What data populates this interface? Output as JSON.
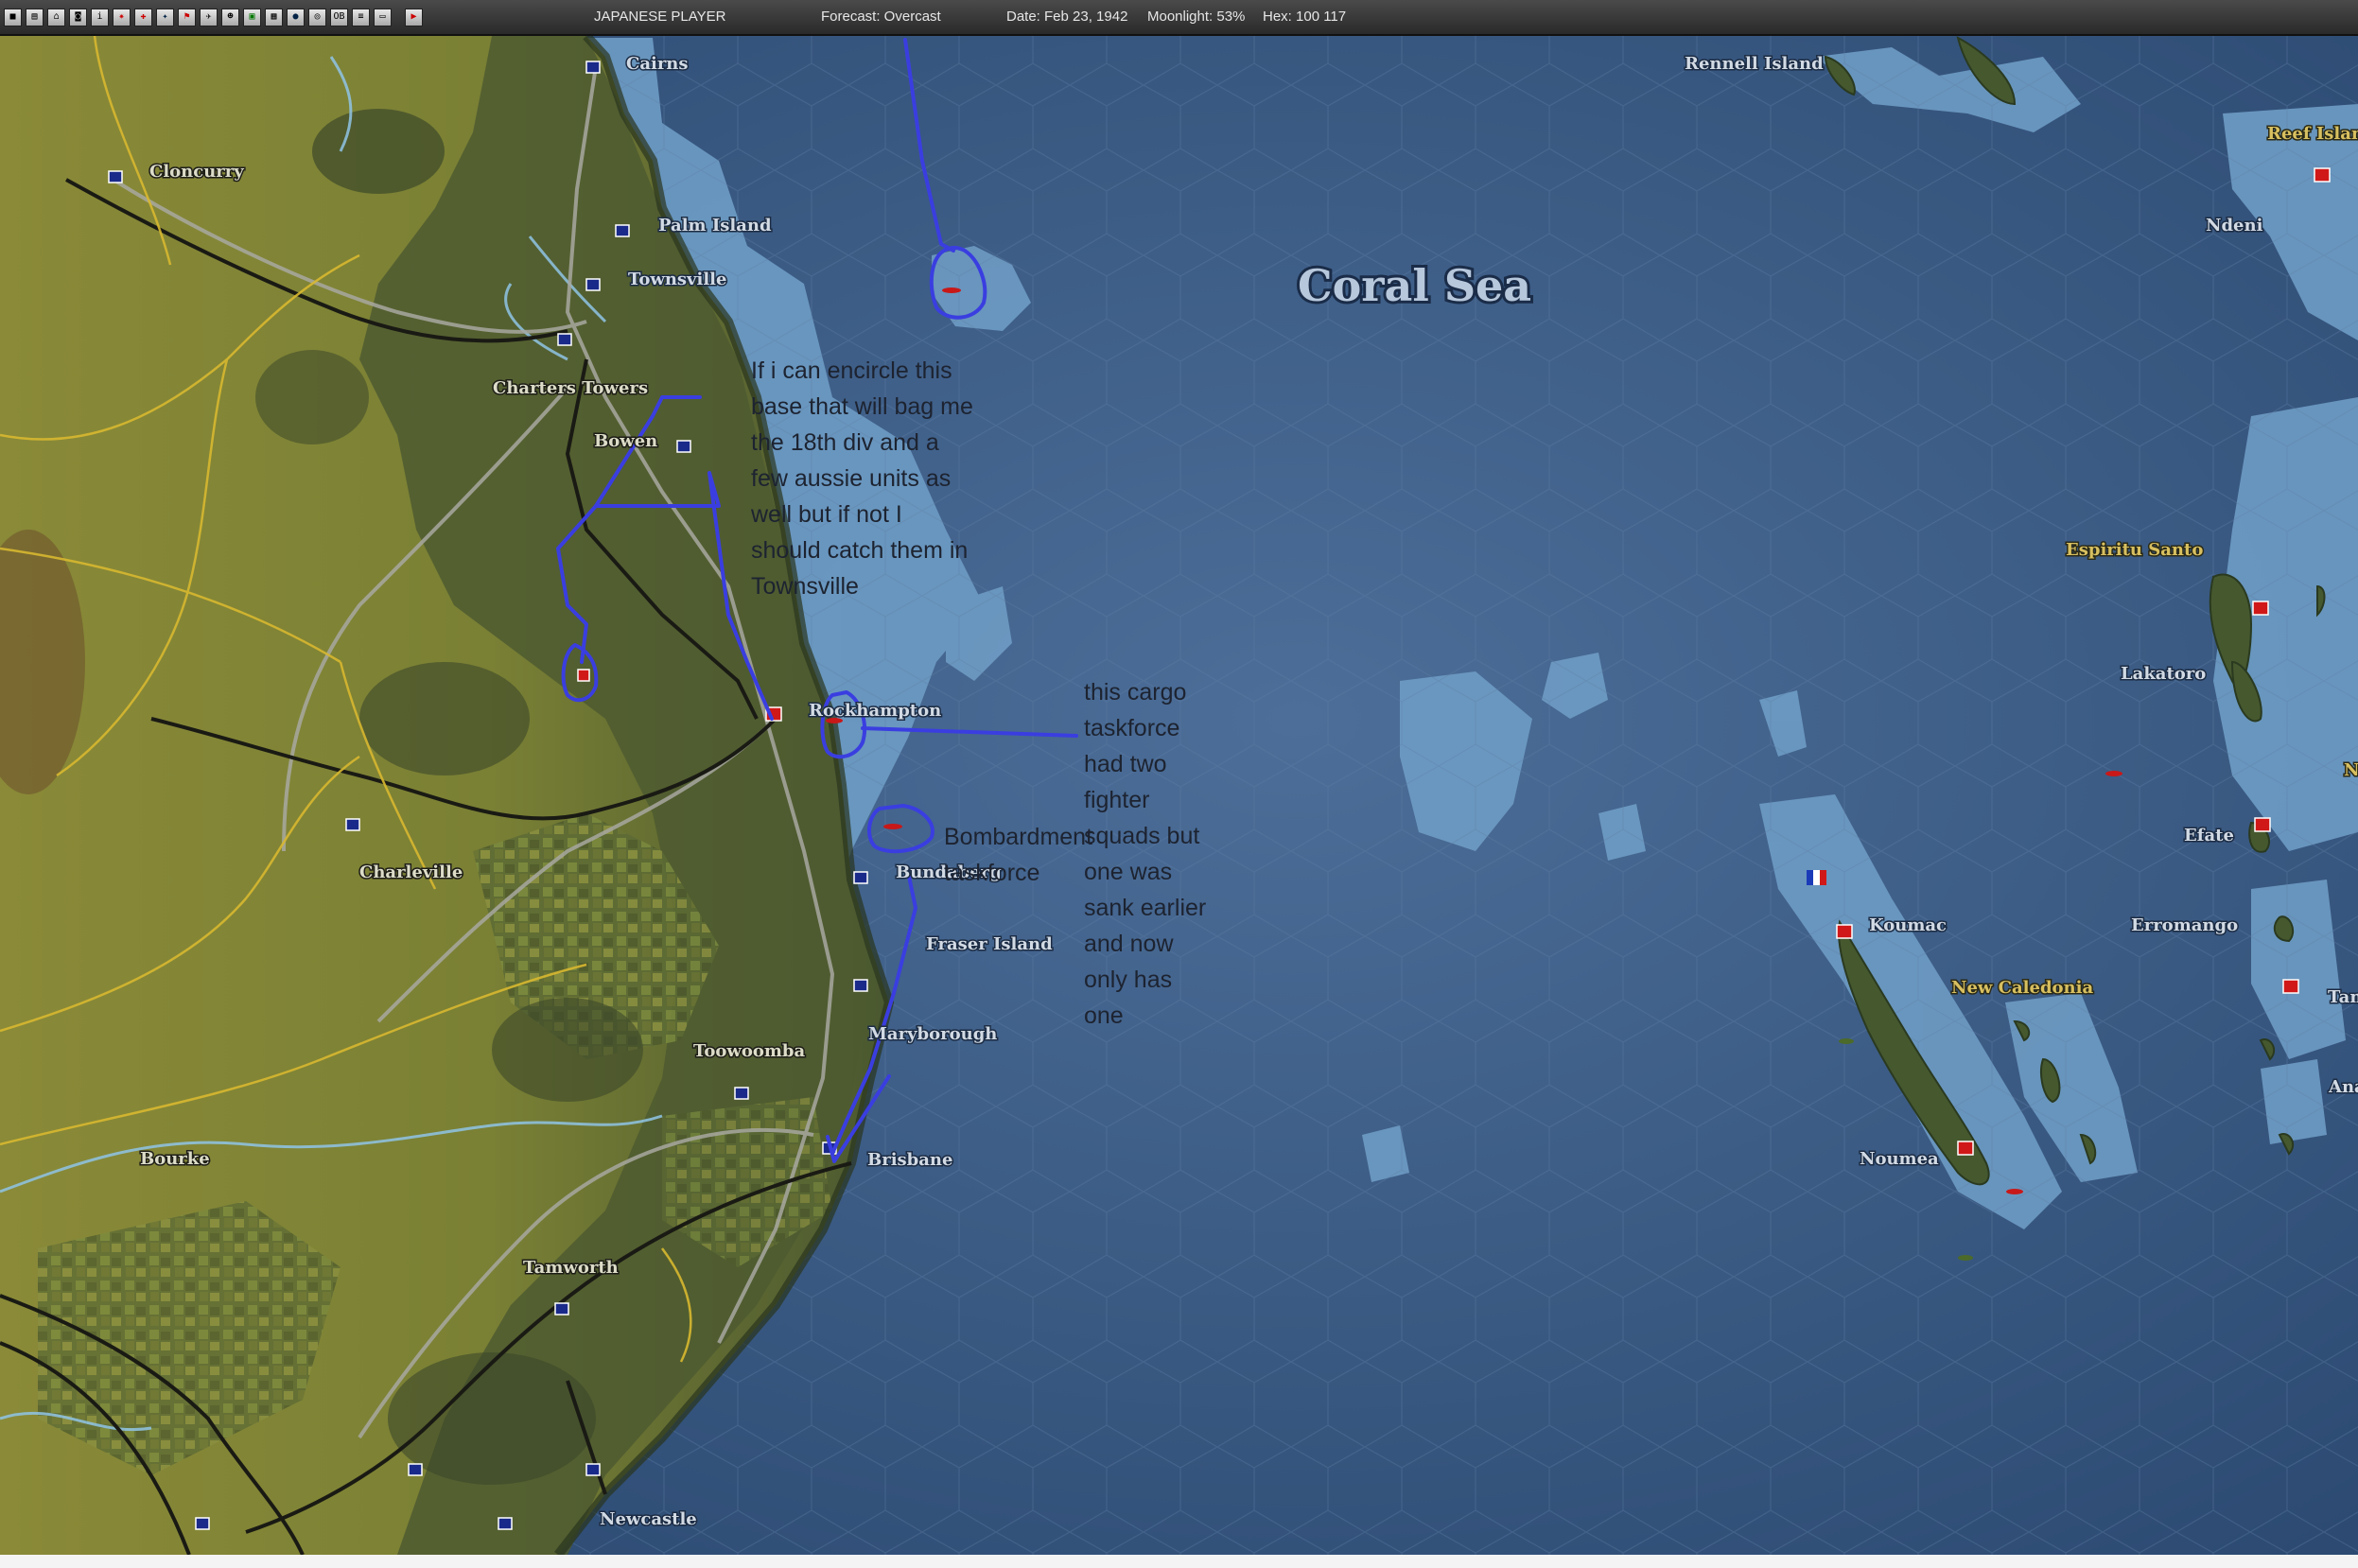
{
  "toolbar": {
    "buttons": [
      "save-icon",
      "report-icon",
      "airgroup-icon",
      "taskforce-icon",
      "info-icon",
      "combat-icon",
      "medical-icon",
      "ship-icon",
      "flag-icon",
      "aircraft-icon",
      "leader-icon",
      "base-icon",
      "unit-icon",
      "globe-icon",
      "intel-icon",
      "ob-icon",
      "list-icon",
      "window-icon",
      "end-turn-icon"
    ],
    "ob_label": "OB",
    "player": "JAPANESE PLAYER",
    "forecast": "Forecast: Overcast",
    "date": "Date: Feb 23, 1942",
    "moonlight": "Moonlight: 53%",
    "hex": "Hex: 100 117"
  },
  "map": {
    "sea_name": "Coral Sea",
    "cities": {
      "cairns": "Cairns",
      "cloncurry": "Cloncurry",
      "palm_island": "Palm Island",
      "townsville": "Townsville",
      "charters_towers": "Charters Towers",
      "bowen": "Bowen",
      "rockhampton": "Rockhampton",
      "bundaberg": "Bundaberg",
      "charleville": "Charleville",
      "fraser_island": "Fraser Island",
      "maryborough": "Maryborough",
      "toowoomba": "Toowoomba",
      "bourke": "Bourke",
      "brisbane": "Brisbane",
      "tamworth": "Tamworth",
      "newcastle": "Newcastle",
      "rennell_island": "Rennell Island",
      "reef_islands": "Reef Islan",
      "ndeni": "Ndeni",
      "espiritu_santo": "Espiritu Santo",
      "lakatoro": "Lakatoro",
      "efate": "Efate",
      "koumac": "Koumac",
      "erromango": "Erromango",
      "new_caledonia": "New Caledonia",
      "tan": "Tan",
      "ana": "Ana",
      "n": "N",
      "noumea": "Noumea"
    }
  },
  "annotations": {
    "note1": [
      "If i can encircle this",
      "base that will bag me",
      "the 18th div and a",
      "few aussie units as",
      "well but if not I",
      "should catch them in",
      "Townsville"
    ],
    "note2": [
      "this cargo",
      "taskforce",
      "had two",
      "fighter",
      "squads but",
      "one was",
      "sank earlier",
      "and now",
      "only has",
      "one"
    ],
    "note3": [
      "Bombardment",
      "taskforce"
    ]
  },
  "colors": {
    "sea_deep": "#2e4f78",
    "sea_shallow": "#6f9ec4",
    "land_olive": "#8e8c34",
    "land_forest": "#46502e",
    "annotation_blue": "#3a3ee0",
    "allied_base_red": "#d01818",
    "toolbar_bg": "#333333"
  }
}
